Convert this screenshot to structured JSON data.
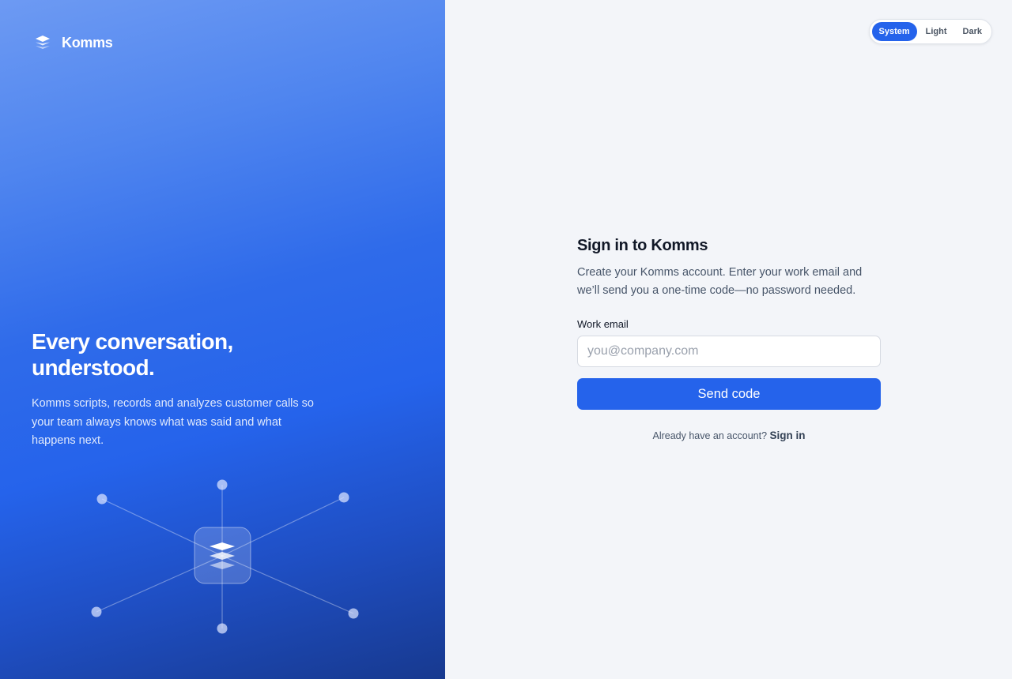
{
  "brand": {
    "name": "Komms",
    "logo_icon": "layers-icon"
  },
  "hero": {
    "title": "Every conversation, understood.",
    "text": "Komms scripts, records and analyzes customer calls so your team always knows what was said and what happens next.",
    "illustration_icon": "layers-icon"
  },
  "theme_switch": {
    "options": [
      "System",
      "Light",
      "Dark"
    ],
    "selected": "System"
  },
  "signin": {
    "title": "Sign in to Komms",
    "subtitle": "Create your Komms account. Enter your work email and we’ll send you a one-time code—no password needed.",
    "email_label": "Work email",
    "email_placeholder": "you@company.com",
    "email_value": "",
    "submit_label": "Send code",
    "alt_prompt": "Already have an account?",
    "alt_link": "Sign in"
  },
  "colors": {
    "accent": "#2563eb",
    "page_bg": "#f3f5f9",
    "hero_gradient_start": "#6d9af3",
    "hero_gradient_end": "#17398f"
  }
}
